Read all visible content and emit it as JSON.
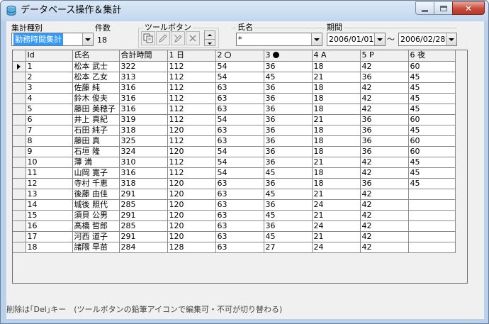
{
  "window": {
    "title": "データベース操作＆集計"
  },
  "filters": {
    "aggregation_label": "集計種別",
    "aggregation_value": "勤務時間集計",
    "count_label": "件数",
    "count_value": "18",
    "toolbar_label": "ツールボタン",
    "name_label": "氏名",
    "name_value": "*",
    "period_label": "期間",
    "period_from": "2006/01/01",
    "period_sep": "～",
    "period_to": "2006/02/28"
  },
  "toolbar": {
    "icons": [
      "copy-icon",
      "edit-pencil-icon",
      "edit-locked-icon",
      "delete-x-icon"
    ]
  },
  "grid": {
    "columns": [
      "Id",
      "氏名",
      "合計時間",
      "1 日",
      "2",
      "3",
      "4 A",
      "5 P",
      "6 夜"
    ],
    "rows": [
      [
        "1",
        "松本 武士",
        "322",
        "112",
        "54",
        "36",
        "18",
        "42",
        "60"
      ],
      [
        "2",
        "松本 乙女",
        "313",
        "112",
        "54",
        "45",
        "21",
        "36",
        "45"
      ],
      [
        "3",
        "佐藤 純",
        "316",
        "112",
        "63",
        "36",
        "18",
        "42",
        "45"
      ],
      [
        "4",
        "鈴木 俊夫",
        "316",
        "112",
        "63",
        "36",
        "18",
        "42",
        "45"
      ],
      [
        "5",
        "藤田 美穂子",
        "316",
        "112",
        "63",
        "36",
        "18",
        "42",
        "45"
      ],
      [
        "6",
        "井上 真紀",
        "319",
        "112",
        "54",
        "36",
        "21",
        "36",
        "60"
      ],
      [
        "7",
        "石田 純子",
        "318",
        "120",
        "63",
        "36",
        "18",
        "36",
        "45"
      ],
      [
        "8",
        "藤田 真",
        "325",
        "112",
        "63",
        "36",
        "18",
        "36",
        "60"
      ],
      [
        "9",
        "石垣 隆",
        "324",
        "120",
        "54",
        "36",
        "18",
        "36",
        "60"
      ],
      [
        "10",
        "薄 満",
        "310",
        "112",
        "54",
        "36",
        "21",
        "42",
        "45"
      ],
      [
        "11",
        "山岡 寛子",
        "316",
        "112",
        "54",
        "45",
        "18",
        "42",
        "45"
      ],
      [
        "12",
        "寺村 千恵",
        "318",
        "120",
        "63",
        "36",
        "18",
        "36",
        "45"
      ],
      [
        "13",
        "後藤 由佳",
        "291",
        "120",
        "63",
        "45",
        "21",
        "42",
        ""
      ],
      [
        "14",
        "城後 照代",
        "285",
        "120",
        "63",
        "36",
        "24",
        "42",
        ""
      ],
      [
        "15",
        "須貝 公男",
        "291",
        "120",
        "63",
        "45",
        "21",
        "42",
        ""
      ],
      [
        "16",
        "髙橋 哲郎",
        "285",
        "120",
        "63",
        "36",
        "24",
        "42",
        ""
      ],
      [
        "17",
        "河西 道子",
        "291",
        "120",
        "63",
        "45",
        "21",
        "42",
        ""
      ],
      [
        "18",
        "諸隈 早苗",
        "284",
        "128",
        "63",
        "27",
        "24",
        "42",
        ""
      ]
    ]
  },
  "status": {
    "text": "削除は｢Del｣キー　(ツールボタンの鉛筆アイコンで編集可・不可が切り替わる)"
  }
}
